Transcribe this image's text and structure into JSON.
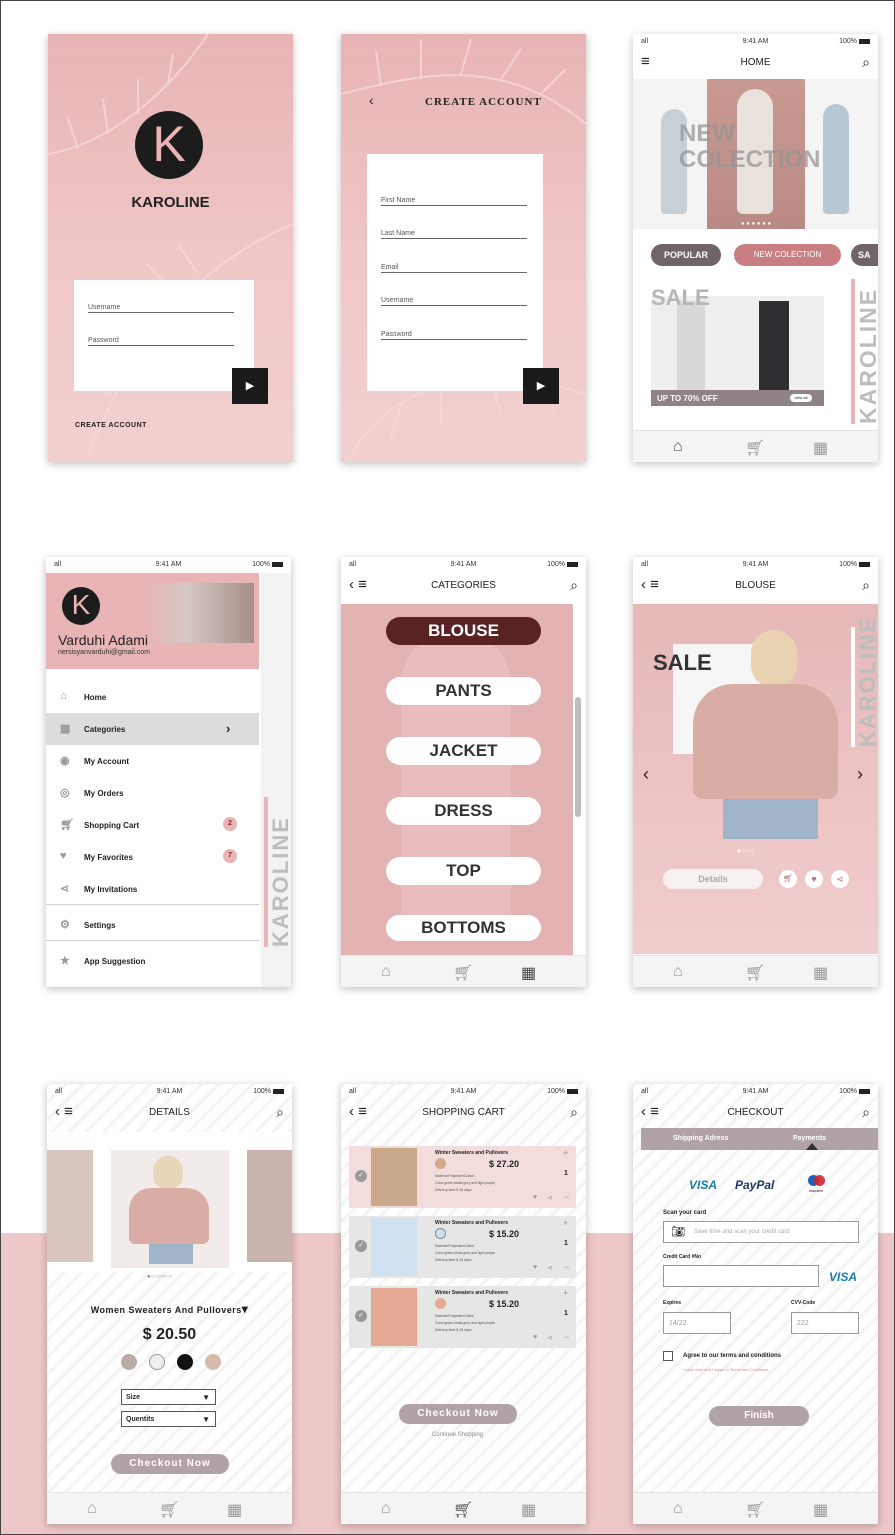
{
  "status": {
    "time": "9:41 AM",
    "battery": "100%",
    "signal": "all"
  },
  "login": {
    "logo_letter": "K",
    "brand": "KAROLINE",
    "username_placeholder": "Username",
    "password_placeholder": "Password",
    "create_account": "CREATE ACCOUNT"
  },
  "create_account": {
    "title": "CREATE ACCOUNT",
    "fields": [
      "First Name",
      "Last Name",
      "Email",
      "Username",
      "Password"
    ]
  },
  "home": {
    "title": "HOME",
    "banner": "NEW COLECTION",
    "chips": [
      "POPULAR",
      "NEW COLECTION",
      "SA"
    ],
    "sale_label": "SALE",
    "sale_strip": "UP TO 70% OFF",
    "view_all": "view all",
    "side_brand": "KAROLINE"
  },
  "menu": {
    "logo_letter": "K",
    "name": "Varduhi Adami",
    "email": "nersisyanvarduhi@gmail.com",
    "items": [
      {
        "label": "Home",
        "icon": "home-icon"
      },
      {
        "label": "Categories",
        "icon": "grid-icon"
      },
      {
        "label": "My Account",
        "icon": "account-icon"
      },
      {
        "label": "My Orders",
        "icon": "orders-icon"
      },
      {
        "label": "Shopping Cart",
        "icon": "cart-icon",
        "badge": "2"
      },
      {
        "label": "My Favorites",
        "icon": "heart-icon",
        "badge": "7"
      },
      {
        "label": "My Invitations",
        "icon": "share-icon"
      },
      {
        "label": "Settings",
        "icon": "gear-icon"
      },
      {
        "label": "App Suggestion",
        "icon": "star-icon"
      }
    ],
    "side_brand": "KAROLINE"
  },
  "categories": {
    "title": "CATEGORIES",
    "items": [
      "BLOUSE",
      "PANTS",
      "JACKET",
      "DRESS",
      "TOP",
      "BOTTOMS"
    ]
  },
  "blouse": {
    "title": "BLOUSE",
    "sale": "SALE",
    "details_button": "Details",
    "side_brand": "KAROLINE"
  },
  "details": {
    "title": "DETAILS",
    "product": "Women Sweaters And Pullovers",
    "price": "$ 20.50",
    "swatches": [
      "#b9aaa9",
      "#eeeeee",
      "#111111",
      "#d8b8a8"
    ],
    "size_label": "Size",
    "quantity_label": "Quentits",
    "checkout": "Checkout Now"
  },
  "cart": {
    "title": "SHOPPING CART",
    "items": [
      {
        "name": "Winter Sweaters and Pullovers",
        "price": "$ 27.20",
        "qty": "1",
        "material": "Material:Polyester/Cotton",
        "colors": "Color:green,khaki,grey and light purple",
        "delivery": "Delivery time:5-15 days",
        "swatch": "#d4a98a"
      },
      {
        "name": "Winter Sweaters and Pullovers",
        "price": "$ 15.20",
        "qty": "1",
        "material": "Material:Polyester/Cotton",
        "colors": "Color:green,khaki,grey and light purple",
        "delivery": "Delivery time:5-15 days",
        "swatch": "#cfe0ee"
      },
      {
        "name": "Winter Sweaters and Pullovers",
        "price": "$ 15.20",
        "qty": "1",
        "material": "Material:Polyester/Cotton",
        "colors": "Color:green,khaki,grey and light purple",
        "delivery": "Delivery time:5-15 days",
        "swatch": "#e6a994"
      }
    ],
    "checkout": "Checkout Now",
    "continue": "Continue Shopping"
  },
  "checkout": {
    "title": "CHECKOUT",
    "tabs": [
      "Shipping Adress",
      "Payments"
    ],
    "visa": "VISA",
    "paypal": "PayPal",
    "maestro": "maestro",
    "scan_label": "Scan your card",
    "scan_placeholder": "Save time and scan your credit card",
    "card_label": "Credit Card #No",
    "expires_label": "Expires",
    "expires_value": "14/22",
    "cvv_label": "CVV-Code",
    "cvv_value": "222",
    "agree": "Agree to our terms and conditions",
    "agree_sub": "I have read and I agree to Terms and Conditions",
    "finish": "Finish"
  },
  "colors": {
    "pink": "#e8b4b5",
    "mauve": "#b0a2a6",
    "dark": "#5a2323"
  }
}
